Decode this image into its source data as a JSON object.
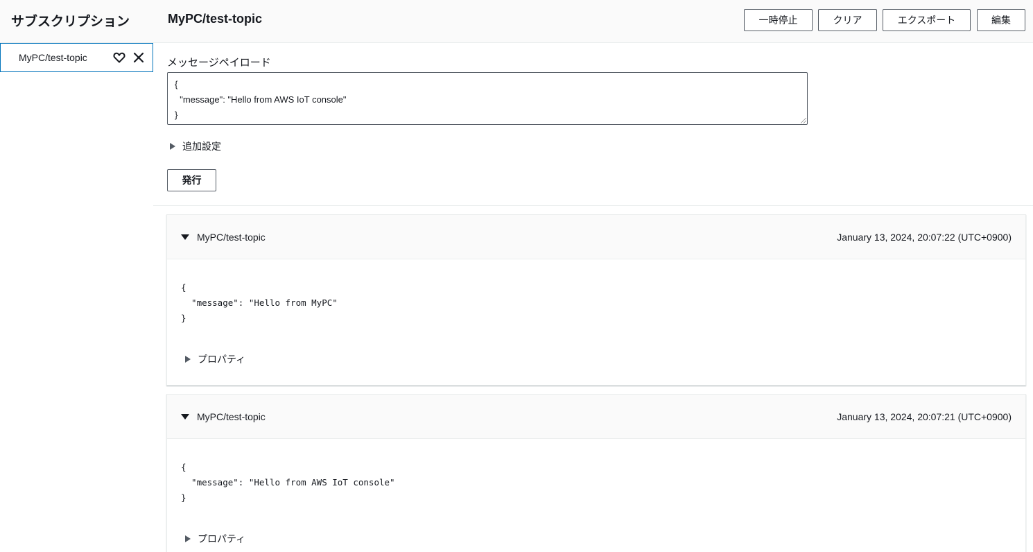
{
  "sidebar": {
    "title": "サブスクリプション",
    "subscription_item": {
      "label": "MyPC/test-topic"
    }
  },
  "header": {
    "topic": "MyPC/test-topic",
    "buttons": {
      "pause": "一時停止",
      "clear": "クリア",
      "export": "エクスポート",
      "edit": "編集"
    }
  },
  "publish": {
    "payload_label": "メッセージペイロード",
    "payload_value": "{\n  \"message\": \"Hello from AWS IoT console\"\n}",
    "additional_settings": "追加設定",
    "publish_button": "発行"
  },
  "messages": [
    {
      "topic": "MyPC/test-topic",
      "timestamp": "January 13, 2024, 20:07:22 (UTC+0900)",
      "payload": "{\n  \"message\": \"Hello from MyPC\"\n}",
      "properties_label": "プロパティ"
    },
    {
      "topic": "MyPC/test-topic",
      "timestamp": "January 13, 2024, 20:07:21 (UTC+0900)",
      "payload": "{\n  \"message\": \"Hello from AWS IoT console\"\n}",
      "properties_label": "プロパティ"
    }
  ],
  "colors": {
    "selected_border": "#0073bb",
    "button_border": "#545b64",
    "header_bg": "#fafafa"
  },
  "icons": [
    "heart-icon",
    "close-icon",
    "caret-right-icon",
    "caret-down-icon"
  ]
}
